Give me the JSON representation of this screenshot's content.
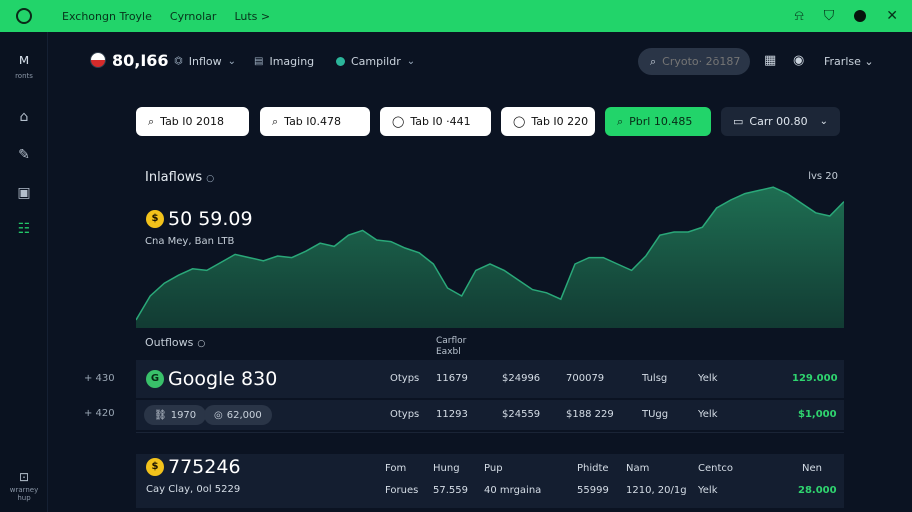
{
  "topbar": {
    "nav": [
      "Exchongn Troyle",
      "Cyrnolar",
      "Luts >"
    ],
    "right_icons": [
      "bell-icon",
      "shield-icon",
      "profile-dot",
      "close-icon"
    ]
  },
  "sidebar": {
    "logo_caption": "ronts",
    "icons": [
      "home-icon",
      "edit-icon",
      "bag-icon",
      "list-icon"
    ],
    "bottom_caption": "wrarney hup"
  },
  "header": {
    "balance": "80,I66",
    "menus": [
      "Inflow",
      "Imaging",
      "Campildr"
    ],
    "search_placeholder": "Cryoto· 2ō187",
    "user": "Frarlse"
  },
  "filters": [
    "Tab I0 2018",
    "Tab I0.478",
    "Tab I0 ·441",
    "Tab I0 220",
    "Pbrl 10.485",
    "Carr 00.80"
  ],
  "chart": {
    "title": "Inlaflows",
    "value": "50 59.09",
    "subtitle": "Cna Mey, Ban LTB",
    "corner_label": "lvs 20"
  },
  "chart_data": {
    "type": "area",
    "x": [
      0,
      2,
      4,
      6,
      8,
      10,
      12,
      14,
      16,
      18,
      20,
      22,
      24,
      26,
      28,
      30,
      32,
      34,
      36,
      38,
      40,
      42,
      44,
      46,
      48,
      50,
      52,
      54,
      56,
      58,
      60,
      62,
      64,
      66,
      68,
      70,
      72,
      74,
      76,
      78,
      80,
      82,
      84,
      86,
      88,
      90,
      92,
      94,
      96,
      98,
      100
    ],
    "y": [
      5,
      20,
      28,
      33,
      37,
      36,
      41,
      46,
      44,
      42,
      45,
      44,
      48,
      53,
      51,
      58,
      61,
      55,
      54,
      50,
      47,
      40,
      25,
      20,
      36,
      40,
      36,
      30,
      24,
      22,
      18,
      40,
      44,
      44,
      40,
      36,
      45,
      58,
      60,
      60,
      63,
      75,
      80,
      84,
      86,
      88,
      84,
      78,
      72,
      70,
      79
    ],
    "ylim": [
      0,
      100
    ],
    "grid": false,
    "legend": "none"
  },
  "table": {
    "section_title": "Outflows",
    "col_head": [
      "Carflor",
      "Eaxbl"
    ],
    "rows": [
      {
        "side": "+ 430",
        "title": "Google 830",
        "cells": [
          "Otyps",
          "11679",
          "$24996",
          "700079",
          "Tulsg",
          "Yelk",
          "129.000"
        ]
      },
      {
        "side": "+ 420",
        "chips": [
          "1970",
          "62,000"
        ],
        "cells": [
          "Otyps",
          "11293",
          "$24559",
          "$188 229",
          "TUgg",
          "Yelk",
          "$1,000"
        ]
      }
    ],
    "bottom": {
      "title": "775246",
      "subtitle": "Cay Clay, 0ol 5229",
      "headers": [
        "Fom",
        "Hung",
        "Pup",
        "Phidte",
        "Nam",
        "Centco",
        "Nen"
      ],
      "values": [
        "Forues",
        "57.559",
        "40 mrgaina",
        "55999",
        "1210, 20/1g",
        "Yelk",
        "28.000"
      ]
    }
  },
  "colors": {
    "accent": "#22d46a",
    "background": "#0b1322",
    "row": "#141e30",
    "chart_fill": "#1b5d48",
    "chart_stroke": "#2aa879"
  }
}
